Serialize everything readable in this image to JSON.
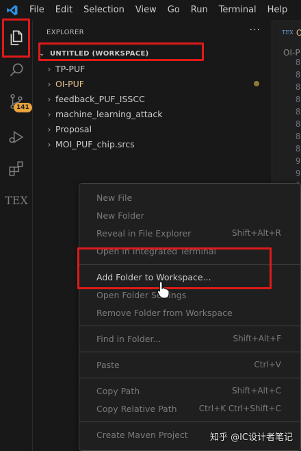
{
  "menubar": {
    "items": [
      "File",
      "Edit",
      "Selection",
      "View",
      "Go",
      "Run",
      "Terminal",
      "Help"
    ]
  },
  "activitybar": {
    "source_control_badge": "141",
    "tex_label": "TEX"
  },
  "sidebar": {
    "title": "EXPLORER",
    "more": "···",
    "workspace": "UNTITLED (WORKSPACE)",
    "folders": [
      {
        "name": "TP-PUF"
      },
      {
        "name": "OI-PUF"
      },
      {
        "name": "feedback_PUF_ISSCC"
      },
      {
        "name": "machine_learning_attack"
      },
      {
        "name": "Proposal"
      },
      {
        "name": "MOI_PUF_chip.srcs"
      }
    ]
  },
  "editor": {
    "tab_icon": "TEX",
    "tab_name": "OI",
    "breadcrumb": "OI-P",
    "line_numbers": [
      "8",
      "8",
      "8",
      "8",
      "8",
      "8",
      "8",
      "8",
      "9",
      "9",
      "9",
      "9",
      "9"
    ]
  },
  "context_menu": {
    "new_file": "New File",
    "new_folder": "New Folder",
    "reveal": "Reveal in File Explorer",
    "reveal_key": "Shift+Alt+R",
    "open_terminal": "Open in Integrated Terminal",
    "add_folder": "Add Folder to Workspace...",
    "open_folder_settings": "Open Folder Settings",
    "remove_folder": "Remove Folder from Workspace",
    "find_in_folder": "Find in Folder...",
    "find_key": "Shift+Alt+F",
    "paste": "Paste",
    "paste_key": "Ctrl+V",
    "copy_path": "Copy Path",
    "copy_path_key": "Shift+Alt+C",
    "copy_relative_path": "Copy Relative Path",
    "copy_relative_key": "Ctrl+K Ctrl+Shift+C",
    "create_maven": "Create Maven Project"
  },
  "watermark": "知乎 @IC设计者笔记",
  "colors": {
    "highlight": "#e01a1a",
    "modified": "#e2c08d",
    "badge": "#e8a33a",
    "vscode_blue": "#2f8fe0"
  }
}
